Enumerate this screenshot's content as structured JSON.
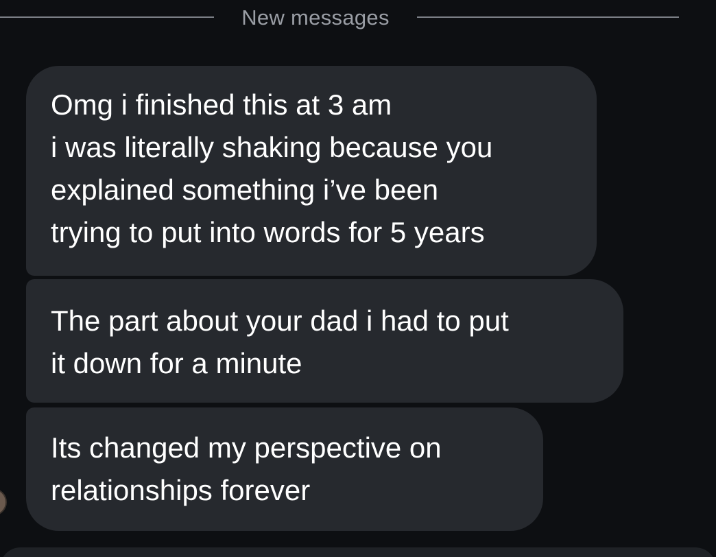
{
  "divider": {
    "label": "New messages"
  },
  "messages": [
    {
      "lines": [
        "Omg i finished this at 3 am",
        "i was literally shaking because you",
        "explained something i’ve been",
        "trying to put into words for 5 years"
      ]
    },
    {
      "lines": [
        "The part about your dad i had to put",
        "it down for a minute"
      ]
    },
    {
      "lines": [
        "Its changed my perspective on",
        "relationships forever"
      ]
    }
  ],
  "colors": {
    "background": "#0d0f12",
    "bubble": "#26292e",
    "text": "#ffffff",
    "divider": "#7b7f86"
  }
}
